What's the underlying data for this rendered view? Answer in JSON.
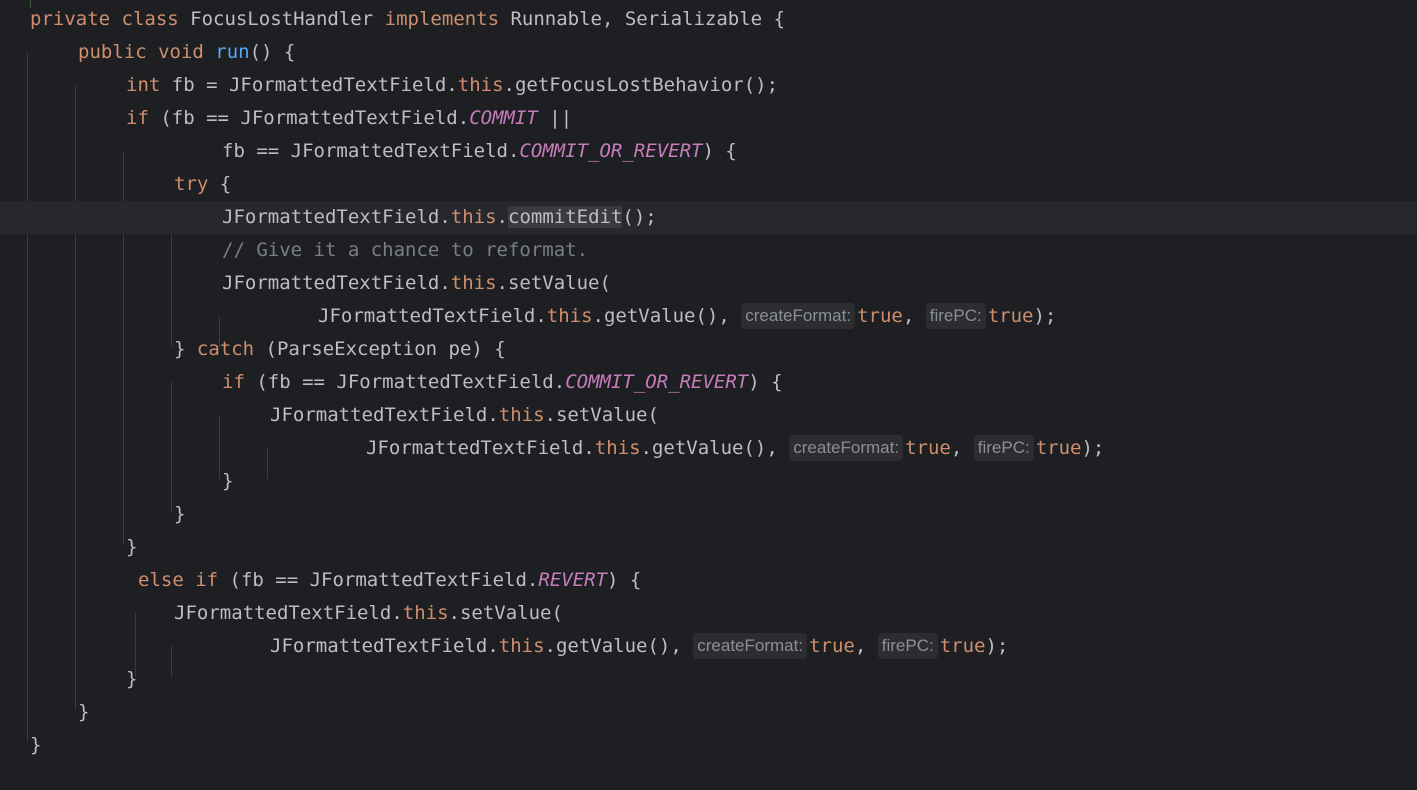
{
  "editor": {
    "lines": [
      {
        "indent": 0,
        "tokens": [
          {
            "t": "private class ",
            "c": "kw"
          },
          {
            "t": "FocusLostHandler ",
            "c": "ident"
          },
          {
            "t": "implements ",
            "c": "kw"
          },
          {
            "t": "Runnable, Serializable {",
            "c": "ident"
          }
        ]
      },
      {
        "indent": 1,
        "tokens": [
          {
            "t": "public void ",
            "c": "kw"
          },
          {
            "t": "run",
            "c": "fn"
          },
          {
            "t": "() {",
            "c": "ident"
          }
        ]
      },
      {
        "indent": 2,
        "tokens": [
          {
            "t": "int ",
            "c": "kw"
          },
          {
            "t": "fb = JFormattedTextField.",
            "c": "ident"
          },
          {
            "t": "this",
            "c": "kw"
          },
          {
            "t": ".getFocusLostBehavior();",
            "c": "ident"
          }
        ]
      },
      {
        "indent": 2,
        "tokens": [
          {
            "t": "if ",
            "c": "kw"
          },
          {
            "t": "(fb == JFormattedTextField.",
            "c": "ident"
          },
          {
            "t": "COMMIT",
            "c": "const"
          },
          {
            "t": " ||",
            "c": "ident"
          }
        ]
      },
      {
        "indent": 4,
        "tokens": [
          {
            "t": "fb == JFormattedTextField.",
            "c": "ident"
          },
          {
            "t": "COMMIT_OR_REVERT",
            "c": "const"
          },
          {
            "t": ") {",
            "c": "ident"
          }
        ]
      },
      {
        "indent": 3,
        "tokens": [
          {
            "t": "try ",
            "c": "kw"
          },
          {
            "t": "{",
            "c": "ident"
          }
        ]
      },
      {
        "indent": 4,
        "current": true,
        "tokens": [
          {
            "t": "JFormattedTextField.",
            "c": "ident"
          },
          {
            "t": "this",
            "c": "kw"
          },
          {
            "t": ".",
            "c": "ident"
          },
          {
            "t": "commitEdit",
            "c": "ident hl"
          },
          {
            "t": "();",
            "c": "ident"
          }
        ]
      },
      {
        "indent": 4,
        "tokens": [
          {
            "t": "// Give it a chance to reformat.",
            "c": "cmt"
          }
        ]
      },
      {
        "indent": 4,
        "tokens": [
          {
            "t": "JFormattedTextField.",
            "c": "ident"
          },
          {
            "t": "this",
            "c": "kw"
          },
          {
            "t": ".setValue(",
            "c": "ident"
          }
        ]
      },
      {
        "indent": 6,
        "tokens": [
          {
            "t": "JFormattedTextField.",
            "c": "ident"
          },
          {
            "t": "this",
            "c": "kw"
          },
          {
            "t": ".getValue(), ",
            "c": "ident"
          },
          {
            "hint": "createFormat:"
          },
          {
            "t": "true",
            "c": "kw"
          },
          {
            "t": ", ",
            "c": "ident"
          },
          {
            "hint": "firePC:"
          },
          {
            "t": "true",
            "c": "kw"
          },
          {
            "t": ");",
            "c": "ident"
          }
        ]
      },
      {
        "indent": 3,
        "tokens": [
          {
            "t": "} ",
            "c": "ident"
          },
          {
            "t": "catch ",
            "c": "kw"
          },
          {
            "t": "(ParseException pe) {",
            "c": "ident"
          }
        ]
      },
      {
        "indent": 4,
        "tokens": [
          {
            "t": "if ",
            "c": "kw"
          },
          {
            "t": "(fb == JFormattedTextField.",
            "c": "ident"
          },
          {
            "t": "COMMIT_OR_REVERT",
            "c": "const"
          },
          {
            "t": ") {",
            "c": "ident"
          }
        ]
      },
      {
        "indent": 5,
        "tokens": [
          {
            "t": "JFormattedTextField.",
            "c": "ident"
          },
          {
            "t": "this",
            "c": "kw"
          },
          {
            "t": ".setValue(",
            "c": "ident"
          }
        ]
      },
      {
        "indent": 7,
        "tokens": [
          {
            "t": "JFormattedTextField.",
            "c": "ident"
          },
          {
            "t": "this",
            "c": "kw"
          },
          {
            "t": ".getValue(), ",
            "c": "ident"
          },
          {
            "hint": "createFormat:"
          },
          {
            "t": "true",
            "c": "kw"
          },
          {
            "t": ", ",
            "c": "ident"
          },
          {
            "hint": "firePC:"
          },
          {
            "t": "true",
            "c": "kw"
          },
          {
            "t": ");",
            "c": "ident"
          }
        ]
      },
      {
        "indent": 4,
        "tokens": [
          {
            "t": "}",
            "c": "ident"
          }
        ]
      },
      {
        "indent": 3,
        "tokens": [
          {
            "t": "}",
            "c": "ident"
          }
        ]
      },
      {
        "indent": 2,
        "tokens": [
          {
            "t": "}",
            "c": "ident"
          }
        ]
      },
      {
        "indent": 2,
        "offset": true,
        "tokens": [
          {
            "t": "else if ",
            "c": "kw"
          },
          {
            "t": "(fb == JFormattedTextField.",
            "c": "ident"
          },
          {
            "t": "REVERT",
            "c": "const"
          },
          {
            "t": ") {",
            "c": "ident"
          }
        ]
      },
      {
        "indent": 3,
        "tokens": [
          {
            "t": "JFormattedTextField.",
            "c": "ident"
          },
          {
            "t": "this",
            "c": "kw"
          },
          {
            "t": ".setValue(",
            "c": "ident"
          }
        ]
      },
      {
        "indent": 5,
        "tokens": [
          {
            "t": "JFormattedTextField.",
            "c": "ident"
          },
          {
            "t": "this",
            "c": "kw"
          },
          {
            "t": ".getValue(), ",
            "c": "ident"
          },
          {
            "hint": "createFormat:"
          },
          {
            "t": "true",
            "c": "kw"
          },
          {
            "t": ", ",
            "c": "ident"
          },
          {
            "hint": "firePC:"
          },
          {
            "t": "true",
            "c": "kw"
          },
          {
            "t": ");",
            "c": "ident"
          }
        ]
      },
      {
        "indent": 2,
        "tokens": [
          {
            "t": "}",
            "c": "ident"
          }
        ]
      },
      {
        "indent": 1,
        "tokens": [
          {
            "t": "}",
            "c": "ident"
          }
        ]
      },
      {
        "indent": 0,
        "tokens": [
          {
            "t": "}",
            "c": "ident"
          }
        ]
      }
    ]
  }
}
